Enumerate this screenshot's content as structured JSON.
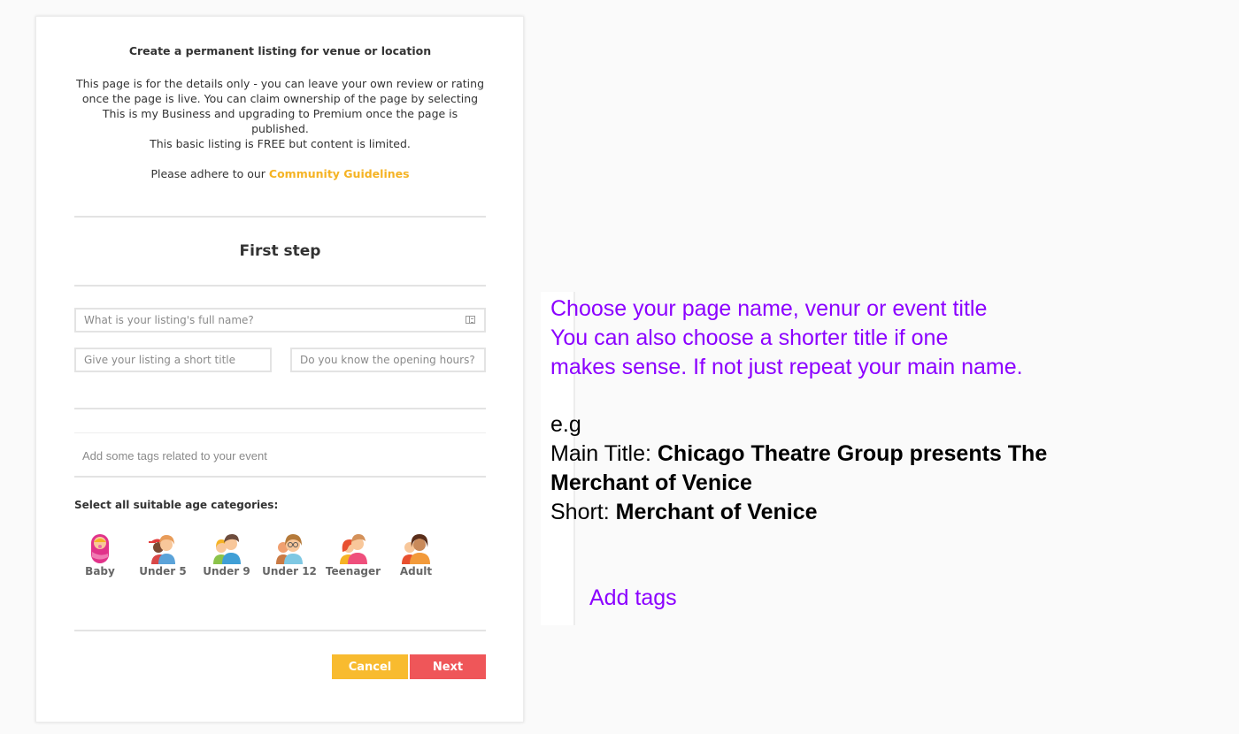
{
  "form": {
    "intro_title": "Create a permanent listing for venue or location",
    "intro_paragraph": "This page is for the details only - you can leave your own review or rating once the page is live. You can claim ownership of the page by selecting This is my Business and upgrading to Premium once the page is published.",
    "free_notice": "This basic listing is FREE but content is limited.",
    "guidelines_prefix": "Please adhere to our ",
    "guidelines_link": "Community Guidelines",
    "step_title": "First step",
    "full_name_placeholder": "What is your listing's full name?",
    "short_title_placeholder": "Give your listing a short title",
    "opening_hours_placeholder": "Do you know the opening hours?",
    "tags_placeholder": "Add some tags related to your event",
    "age_label": "Select all suitable age categories:",
    "age_categories": [
      {
        "label": "Baby",
        "icon": "baby-icon"
      },
      {
        "label": "Under 5",
        "icon": "under-5-icon"
      },
      {
        "label": "Under 9",
        "icon": "under-9-icon"
      },
      {
        "label": "Under 12",
        "icon": "under-12-icon"
      },
      {
        "label": "Teenager",
        "icon": "teenager-icon"
      },
      {
        "label": "Adult",
        "icon": "adult-icon"
      }
    ],
    "cancel_label": "Cancel",
    "next_label": "Next",
    "colors": {
      "link": "#f5b324",
      "cancel": "#f8bb2f",
      "next": "#ef5659"
    }
  },
  "annotation": {
    "instruction_lines": [
      "Choose your page name, venur or event title",
      "You can also choose a shorter title if one",
      "makes sense. If not just repeat your main name."
    ],
    "example_prefix": "e.g",
    "main_title_label": "Main Title: ",
    "main_title_value": "Chicago Theatre Group presents The Merchant of Venice",
    "short_label": "Short: ",
    "short_value": "Merchant of Venice",
    "add_tags": "Add tags",
    "colors": {
      "instruction": "#8b00ff",
      "example": "#000000"
    }
  }
}
